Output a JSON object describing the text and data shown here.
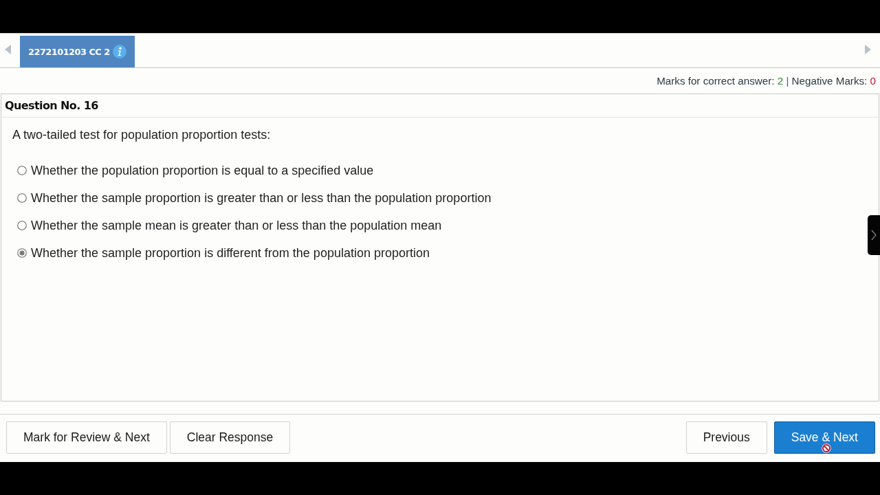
{
  "tabs": [
    {
      "label": "2272101203 CC 2",
      "selected": true
    }
  ],
  "marks": {
    "correct_label": "Marks for correct answer:",
    "correct_value": "2",
    "separator": "|",
    "negative_label": "Negative Marks:",
    "negative_value": "0"
  },
  "question": {
    "title": "Question No. 16",
    "text": "A two-tailed test for population proportion tests:",
    "options": [
      {
        "label": "Whether the population proportion is equal to a specified value",
        "selected": false
      },
      {
        "label": "Whether the sample proportion is greater than or less than the population proportion",
        "selected": false
      },
      {
        "label": "Whether the sample mean is greater than or less than the population mean",
        "selected": false
      },
      {
        "label": "Whether the sample proportion is different from the population proportion",
        "selected": true
      }
    ]
  },
  "actions_left": [
    {
      "label": "Mark for Review & Next",
      "kind": "default"
    },
    {
      "label": "Clear Response",
      "kind": "default"
    }
  ],
  "actions_right": [
    {
      "label": "Previous",
      "kind": "default"
    },
    {
      "label": "Save & Next",
      "kind": "primary"
    }
  ]
}
